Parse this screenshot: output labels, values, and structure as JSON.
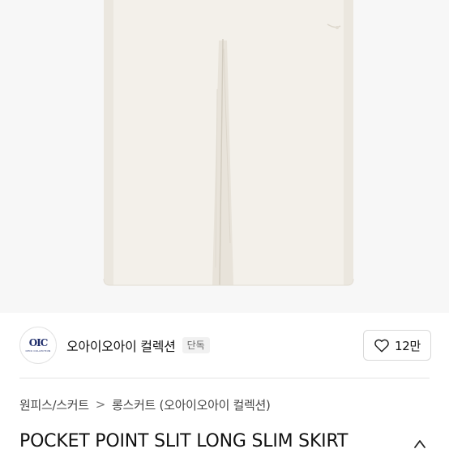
{
  "brand": {
    "logo_mark": "OIC",
    "logo_sub": "OHIO COLLECTION",
    "name": "오아이오아이 컬렉션",
    "badge": "단독"
  },
  "like": {
    "icon": "heart-outline-icon",
    "count": "12만"
  },
  "breadcrumb": {
    "category": "원피스/스커트",
    "separator": ">",
    "subcategory": "롱스커트 (오아이오아이 컬렉션)"
  },
  "product": {
    "title": "POCKET POINT SLIT LONG SLIM SKIRT_",
    "image_icon": "product-photo"
  },
  "colors": {
    "skirt": "#f3f0ea",
    "background": "#f7f7f7",
    "brand_navy": "#1f2d6b"
  }
}
